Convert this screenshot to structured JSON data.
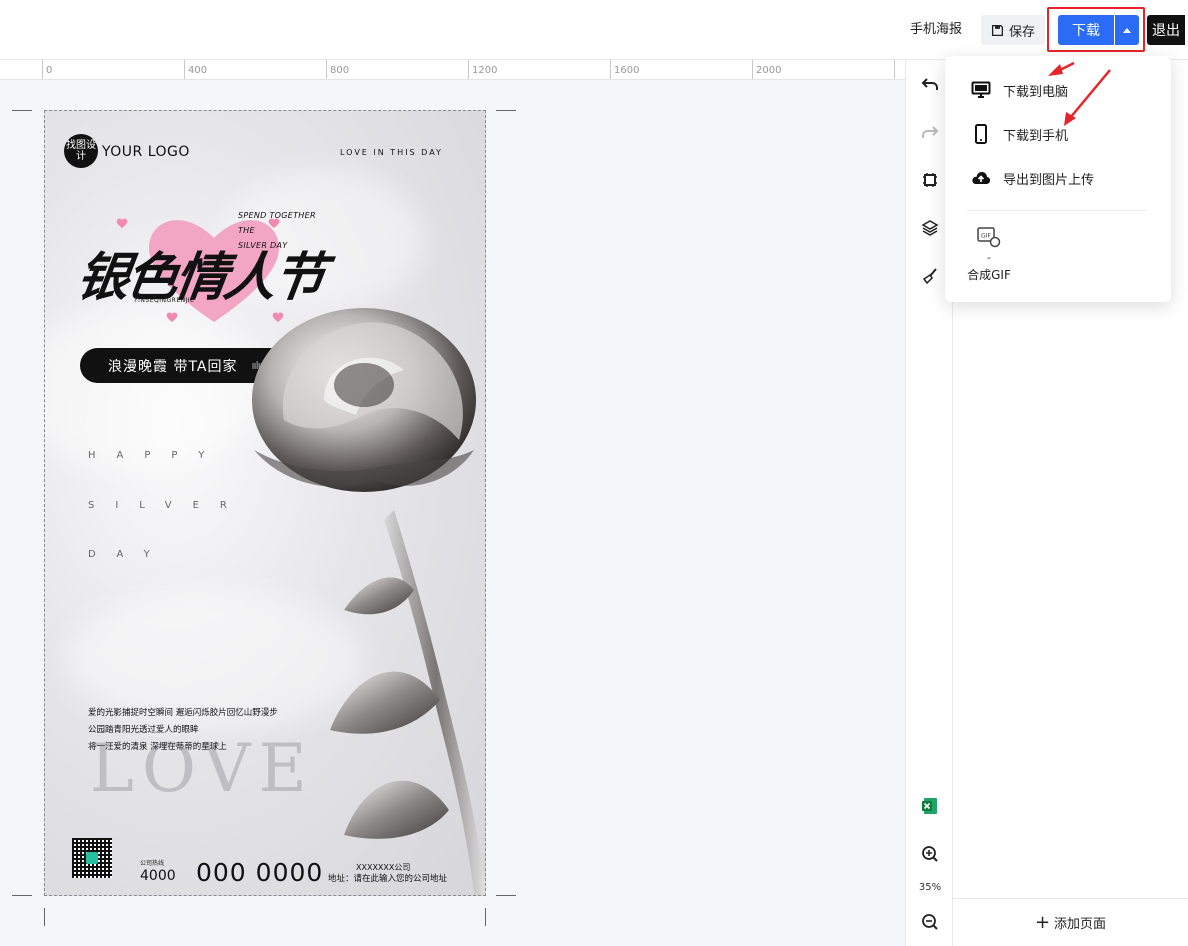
{
  "topbar": {
    "mobile_poster": "手机海报",
    "save": "保存",
    "download": "下载",
    "exit": "退出"
  },
  "ruler": {
    "labels": [
      "0",
      "400",
      "800",
      "1200",
      "1600",
      "2000"
    ]
  },
  "poster": {
    "logo_badge": "找图设计",
    "logo_text": "YOUR LOGO",
    "tagline_top": "LOVE IN THIS DAY",
    "spend_lines": [
      "SPEND TOGETHER",
      "THE",
      "SILVER DAY"
    ],
    "title": "银色情人节",
    "title_pinyin": "YINSEQINGRENJIE",
    "slogan": "浪漫晚霞 带TA回家",
    "slogan_bars": "ıılıı",
    "spaced_lines": [
      "HAPPY",
      "SILVER",
      "DAY"
    ],
    "body_lines": [
      "爱的光影捕捉时空瞬间 邂逅闪烁胶片回忆山野漫步",
      "公园踏青阳光透过爱人的眼眸",
      "将一汪爱的清泉 深埋在蒂蒂的星球上"
    ],
    "love_big": "LOVE",
    "phone_label": "公司热线",
    "phone_prefix": "4000",
    "phone_number": "000 0000",
    "company": "XXXXXXX公司",
    "address": "地址：请在此输入您的公司地址"
  },
  "tools": {
    "zoom_level": "35%"
  },
  "right_panel": {
    "add_page": "添加页面"
  },
  "dropdown": {
    "items": [
      {
        "label": "下载到电脑",
        "icon": "monitor-icon"
      },
      {
        "label": "下载到手机",
        "icon": "phone-icon"
      },
      {
        "label": "导出到图片上传",
        "icon": "cloud-upload-icon"
      }
    ],
    "gif_dash": "-",
    "gif_label": "合成GIF"
  },
  "colors": {
    "primary": "#2a6cf6",
    "highlight": "#e8242a",
    "heart": "#f2a6c4"
  }
}
